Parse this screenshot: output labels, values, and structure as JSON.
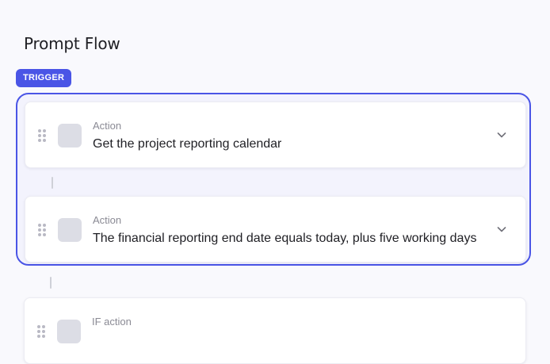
{
  "page": {
    "title": "Prompt Flow"
  },
  "trigger": {
    "badge_label": "TRIGGER",
    "steps": [
      {
        "type_label": "Action",
        "text": "Get the project reporting calendar",
        "icon": "step-icon-placeholder",
        "expand_icon": "chevron-down-icon"
      },
      {
        "type_label": "Action",
        "text": "The financial reporting end date equals today, plus five working days",
        "icon": "step-icon-placeholder",
        "expand_icon": "chevron-down-icon"
      }
    ]
  },
  "next_steps": [
    {
      "type_label": "IF action",
      "icon": "step-icon-placeholder"
    }
  ],
  "colors": {
    "accent": "#4a55e6",
    "background": "#f9f9fd",
    "group_fill": "#f3f3fd",
    "card_border": "#ececf3",
    "icon_placeholder": "#dcdde5",
    "secondary_text": "#8a8a94"
  }
}
